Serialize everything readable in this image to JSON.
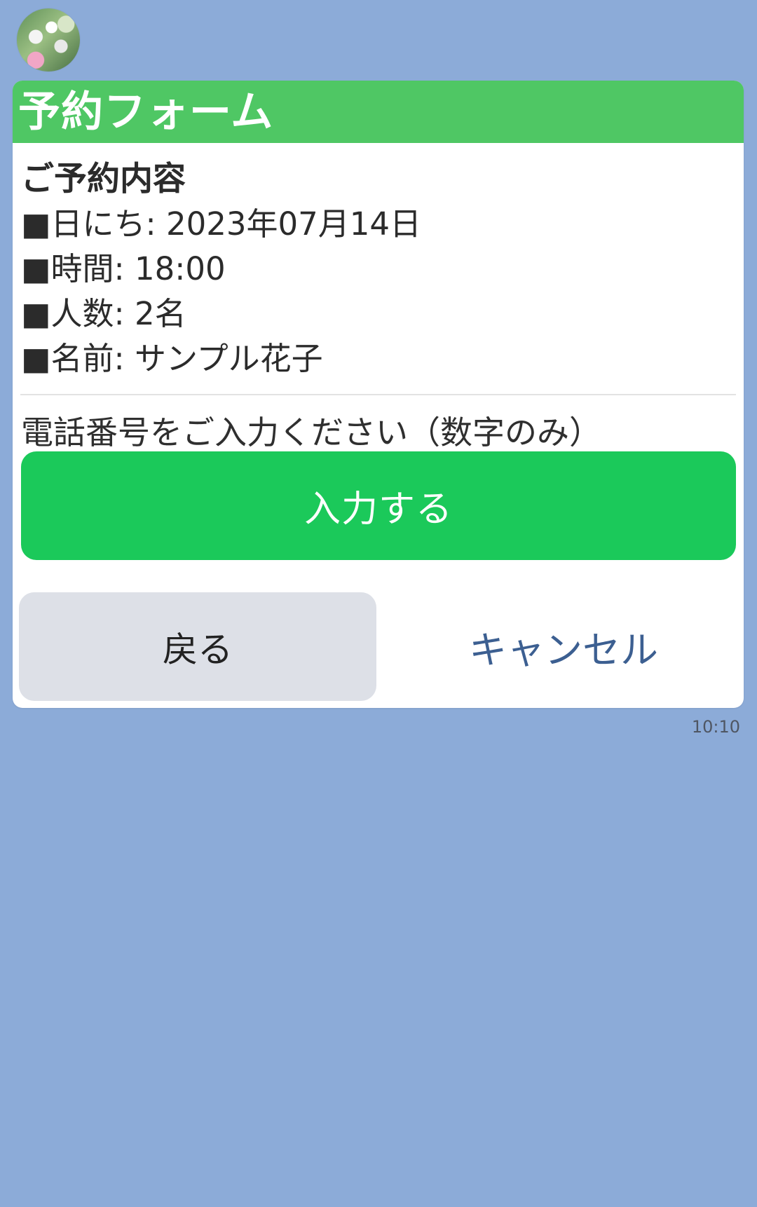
{
  "chat": {
    "avatar_icon": "profile-photo-icon",
    "time": "10:10"
  },
  "form": {
    "title": "予約フォーム",
    "section_title": "ご予約内容",
    "lines": [
      "■日にち: 2023年07月14日",
      "■時間: 18:00",
      "■人数: 2名",
      "■名前: サンプル花子"
    ],
    "prompt": "電話番号をご入力ください（数字のみ）",
    "primary_button": "入力する",
    "back_button": "戻る",
    "cancel_button": "キャンセル"
  },
  "colors": {
    "background": "#8cabd8",
    "header": "#4fc764",
    "primary_button": "#1bc95a",
    "secondary_button": "#dde0e7",
    "cancel_text": "#3c5f91"
  }
}
